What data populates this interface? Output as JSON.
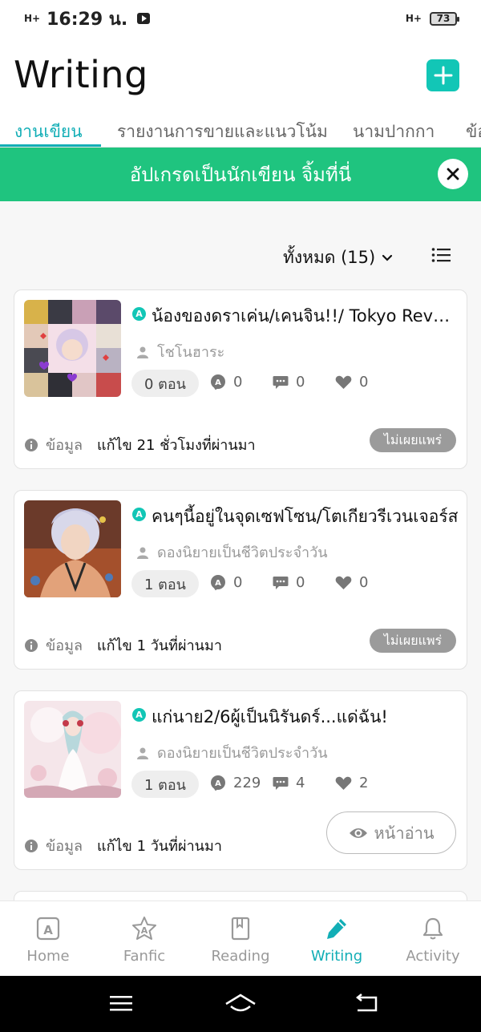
{
  "status_bar": {
    "signal": "H+",
    "time": "16:29 น.",
    "network": "H+",
    "battery": "73"
  },
  "header": {
    "title": "Writing"
  },
  "tabs": [
    {
      "label": "งานเขียน",
      "active": true
    },
    {
      "label": "รายงานการขายและแนวโน้ม",
      "active": false
    },
    {
      "label": "นามปากกา",
      "active": false
    },
    {
      "label": "ข้อ",
      "active": false
    }
  ],
  "banner": {
    "text": "อัปเกรดเป็นนักเขียน จิ้มที่นี่"
  },
  "filter": {
    "label": "ทั้งหมด (15)"
  },
  "stories": [
    {
      "title": "น้องของดราเค่น/เคนจิน!!/ Tokyo Revengers",
      "author": "โชโนฮาระ",
      "episodes": "0 ตอน",
      "views": "0",
      "comments": "0",
      "likes": "0",
      "info_label": "ข้อมูล",
      "edited": "แก้ไข 21 ชั่วโมงที่ผ่านมา",
      "status": "ไม่เผยแพร่"
    },
    {
      "title": "คนๆนี้อยู่ในจุดเซฟโซน/โตเกียวรีเวนเจอร์ส",
      "author": "ดองนิยายเป็นชีวิตประจำวัน",
      "episodes": "1 ตอน",
      "views": "0",
      "comments": "0",
      "likes": "0",
      "info_label": "ข้อมูล",
      "edited": "แก้ไข 1 วันที่ผ่านมา",
      "status": "ไม่เผยแพร่"
    },
    {
      "title": "แก่นาย2/6ผู้เป็นนิรันดร์...แด่ฉัน!",
      "author": "ดองนิยายเป็นชีวิตประจำวัน",
      "episodes": "1 ตอน",
      "views": "229",
      "comments": "4",
      "likes": "2",
      "info_label": "ข้อมูล",
      "edited": "แก้ไข 1 วันที่ผ่านมา",
      "read_button": "หน้าอ่าน"
    }
  ],
  "bottom_nav": [
    {
      "label": "Home",
      "icon": "home-a-icon"
    },
    {
      "label": "Fanfic",
      "icon": "fanfic-star-icon"
    },
    {
      "label": "Reading",
      "icon": "book-icon"
    },
    {
      "label": "Writing",
      "icon": "pencil-icon",
      "active": true
    },
    {
      "label": "Activity",
      "icon": "bell-icon"
    }
  ],
  "colors": {
    "accent": "#12aeb6",
    "brand_teal": "#12c6b6",
    "banner_green": "#1fc47f",
    "unpublished_gray": "#9b9b9b"
  }
}
